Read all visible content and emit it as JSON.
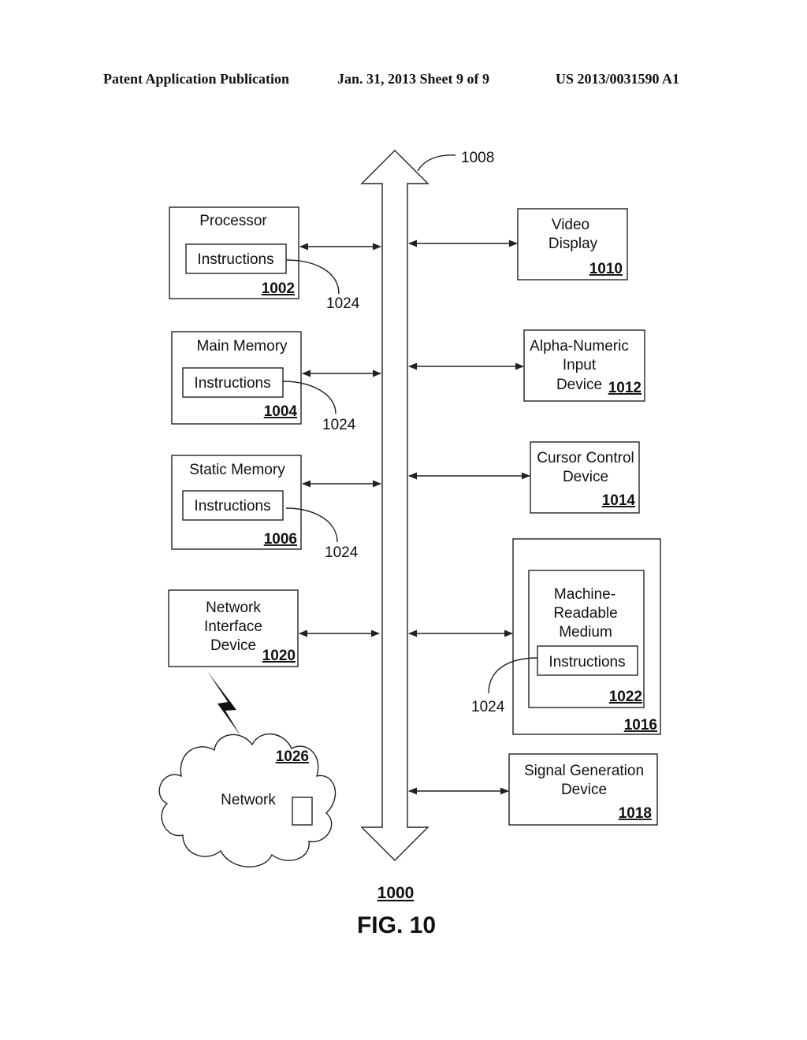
{
  "header": {
    "left": "Patent Application Publication",
    "center": "Jan. 31, 2013   Sheet 9 of 9",
    "right": "US 2013/0031590 A1"
  },
  "bus": {
    "ref": "1008"
  },
  "left_blocks": [
    {
      "title": "Processor",
      "inner": "Instructions",
      "ref": "1002",
      "callout": "1024"
    },
    {
      "title": "Main Memory",
      "inner": "Instructions",
      "ref": "1004",
      "callout": "1024"
    },
    {
      "title": "Static Memory",
      "inner": "Instructions",
      "ref": "1006",
      "callout": "1024"
    },
    {
      "title_lines": [
        "Network",
        "Interface",
        "Device"
      ],
      "ref": "1020"
    }
  ],
  "right_blocks": [
    {
      "title_lines": [
        "Video",
        "Display"
      ],
      "ref": "1010"
    },
    {
      "title_lines": [
        "Alpha-Numeric",
        "Input",
        "Device"
      ],
      "ref": "1012"
    },
    {
      "title_lines": [
        "Cursor Control",
        "Device"
      ],
      "ref": "1014"
    },
    {
      "title_lines": [
        "Machine-",
        "Readable",
        "Medium"
      ],
      "inner": "Instructions",
      "inner_ref": "1022",
      "ref": "1016",
      "callout": "1024"
    },
    {
      "title_lines": [
        "Signal Generation",
        "Device"
      ],
      "ref": "1018"
    }
  ],
  "network": {
    "label": "Network",
    "ref": "1026"
  },
  "figure": {
    "ref": "1000",
    "caption": "FIG. 10"
  }
}
